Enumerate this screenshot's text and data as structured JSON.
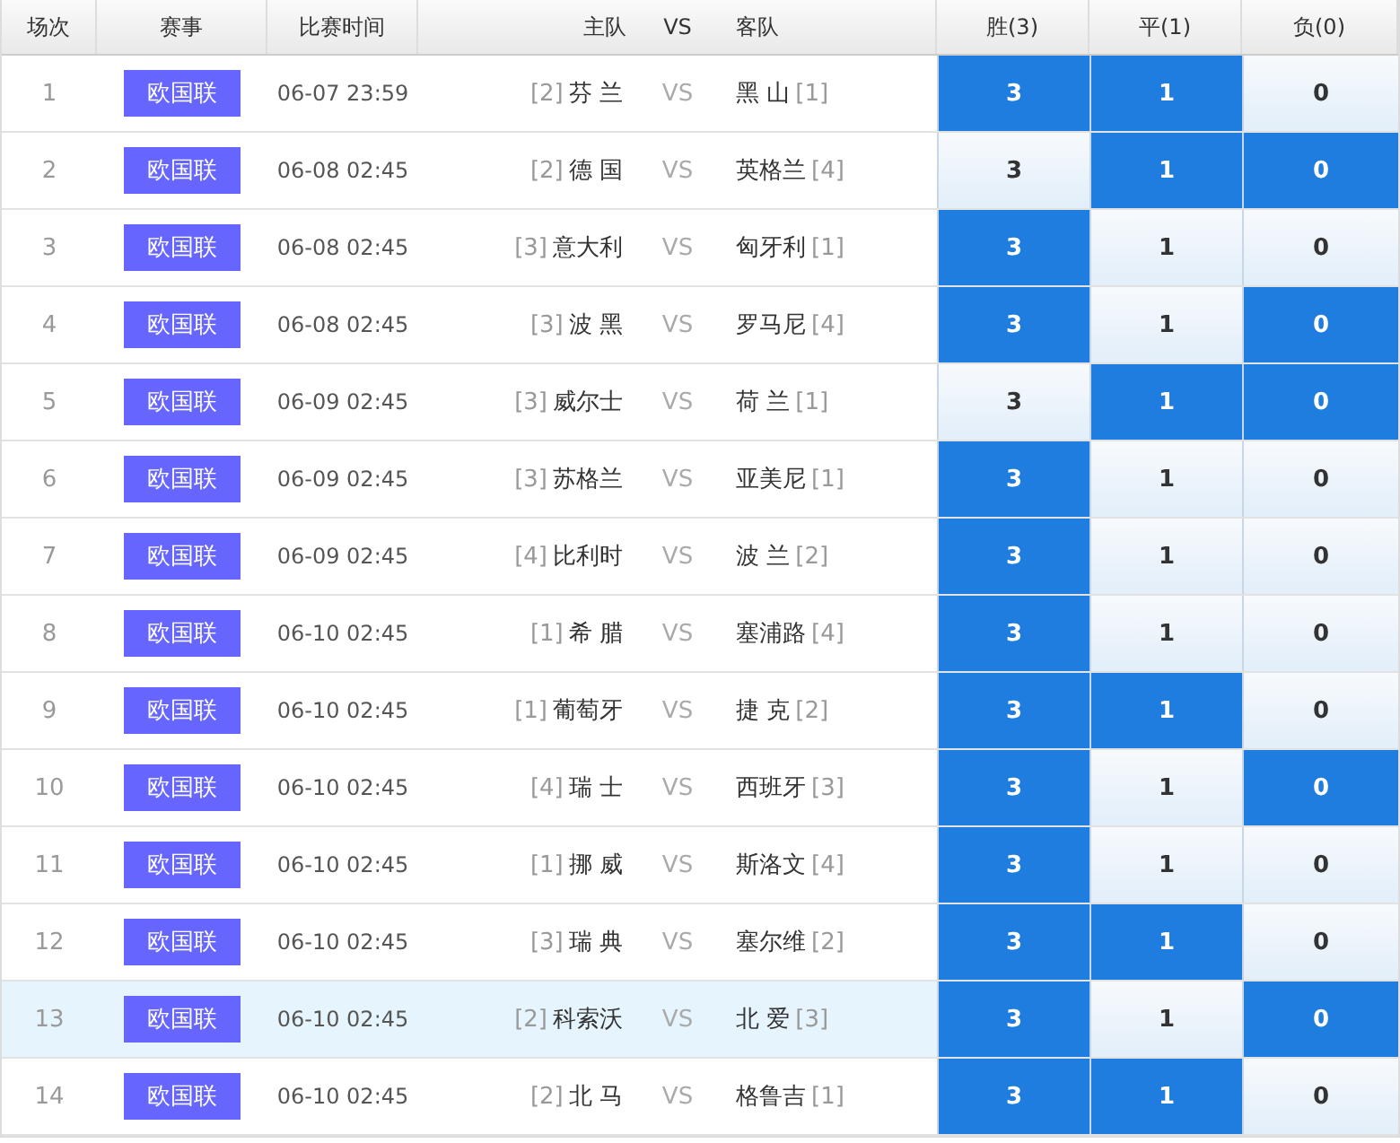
{
  "columns": [
    "场次",
    "赛事",
    "比赛时间",
    "主队",
    "VS",
    "客队",
    "胜(3)",
    "平(1)",
    "负(0)"
  ],
  "rows": [
    {
      "no": "1",
      "league": "欧国联",
      "time": "06-07 23:59",
      "home_rank": "[2]",
      "home": "芬 兰",
      "vs": "VS",
      "away": "黑 山",
      "away_rank": "[1]",
      "highlighted": false,
      "odds": [
        {
          "label": "3",
          "selected": true
        },
        {
          "label": "1",
          "selected": true
        },
        {
          "label": "0",
          "selected": false
        }
      ]
    },
    {
      "no": "2",
      "league": "欧国联",
      "time": "06-08 02:45",
      "home_rank": "[2]",
      "home": "德 国",
      "vs": "VS",
      "away": "英格兰",
      "away_rank": "[4]",
      "highlighted": false,
      "odds": [
        {
          "label": "3",
          "selected": false
        },
        {
          "label": "1",
          "selected": true
        },
        {
          "label": "0",
          "selected": true
        }
      ]
    },
    {
      "no": "3",
      "league": "欧国联",
      "time": "06-08 02:45",
      "home_rank": "[3]",
      "home": "意大利",
      "vs": "VS",
      "away": "匈牙利",
      "away_rank": "[1]",
      "highlighted": false,
      "odds": [
        {
          "label": "3",
          "selected": true
        },
        {
          "label": "1",
          "selected": false
        },
        {
          "label": "0",
          "selected": false
        }
      ]
    },
    {
      "no": "4",
      "league": "欧国联",
      "time": "06-08 02:45",
      "home_rank": "[3]",
      "home": "波 黑",
      "vs": "VS",
      "away": "罗马尼",
      "away_rank": "[4]",
      "highlighted": false,
      "odds": [
        {
          "label": "3",
          "selected": true
        },
        {
          "label": "1",
          "selected": false
        },
        {
          "label": "0",
          "selected": true
        }
      ]
    },
    {
      "no": "5",
      "league": "欧国联",
      "time": "06-09 02:45",
      "home_rank": "[3]",
      "home": "威尔士",
      "vs": "VS",
      "away": "荷 兰",
      "away_rank": "[1]",
      "highlighted": false,
      "odds": [
        {
          "label": "3",
          "selected": false
        },
        {
          "label": "1",
          "selected": true
        },
        {
          "label": "0",
          "selected": true
        }
      ]
    },
    {
      "no": "6",
      "league": "欧国联",
      "time": "06-09 02:45",
      "home_rank": "[3]",
      "home": "苏格兰",
      "vs": "VS",
      "away": "亚美尼",
      "away_rank": "[1]",
      "highlighted": false,
      "odds": [
        {
          "label": "3",
          "selected": true
        },
        {
          "label": "1",
          "selected": false
        },
        {
          "label": "0",
          "selected": false
        }
      ]
    },
    {
      "no": "7",
      "league": "欧国联",
      "time": "06-09 02:45",
      "home_rank": "[4]",
      "home": "比利时",
      "vs": "VS",
      "away": "波 兰",
      "away_rank": "[2]",
      "highlighted": false,
      "odds": [
        {
          "label": "3",
          "selected": true
        },
        {
          "label": "1",
          "selected": false
        },
        {
          "label": "0",
          "selected": false
        }
      ]
    },
    {
      "no": "8",
      "league": "欧国联",
      "time": "06-10 02:45",
      "home_rank": "[1]",
      "home": "希 腊",
      "vs": "VS",
      "away": "塞浦路",
      "away_rank": "[4]",
      "highlighted": false,
      "odds": [
        {
          "label": "3",
          "selected": true
        },
        {
          "label": "1",
          "selected": false
        },
        {
          "label": "0",
          "selected": false
        }
      ]
    },
    {
      "no": "9",
      "league": "欧国联",
      "time": "06-10 02:45",
      "home_rank": "[1]",
      "home": "葡萄牙",
      "vs": "VS",
      "away": "捷 克",
      "away_rank": "[2]",
      "highlighted": false,
      "odds": [
        {
          "label": "3",
          "selected": true
        },
        {
          "label": "1",
          "selected": true
        },
        {
          "label": "0",
          "selected": false
        }
      ]
    },
    {
      "no": "10",
      "league": "欧国联",
      "time": "06-10 02:45",
      "home_rank": "[4]",
      "home": "瑞 士",
      "vs": "VS",
      "away": "西班牙",
      "away_rank": "[3]",
      "highlighted": false,
      "odds": [
        {
          "label": "3",
          "selected": true
        },
        {
          "label": "1",
          "selected": false
        },
        {
          "label": "0",
          "selected": true
        }
      ]
    },
    {
      "no": "11",
      "league": "欧国联",
      "time": "06-10 02:45",
      "home_rank": "[1]",
      "home": "挪 威",
      "vs": "VS",
      "away": "斯洛文",
      "away_rank": "[4]",
      "highlighted": false,
      "odds": [
        {
          "label": "3",
          "selected": true
        },
        {
          "label": "1",
          "selected": false
        },
        {
          "label": "0",
          "selected": false
        }
      ]
    },
    {
      "no": "12",
      "league": "欧国联",
      "time": "06-10 02:45",
      "home_rank": "[3]",
      "home": "瑞 典",
      "vs": "VS",
      "away": "塞尔维",
      "away_rank": "[2]",
      "highlighted": false,
      "odds": [
        {
          "label": "3",
          "selected": true
        },
        {
          "label": "1",
          "selected": true
        },
        {
          "label": "0",
          "selected": false
        }
      ]
    },
    {
      "no": "13",
      "league": "欧国联",
      "time": "06-10 02:45",
      "home_rank": "[2]",
      "home": "科索沃",
      "vs": "VS",
      "away": "北 爱",
      "away_rank": "[3]",
      "highlighted": true,
      "odds": [
        {
          "label": "3",
          "selected": true
        },
        {
          "label": "1",
          "selected": false
        },
        {
          "label": "0",
          "selected": true
        }
      ]
    },
    {
      "no": "14",
      "league": "欧国联",
      "time": "06-10 02:45",
      "home_rank": "[2]",
      "home": "北 马",
      "vs": "VS",
      "away": "格鲁吉",
      "away_rank": "[1]",
      "highlighted": false,
      "odds": [
        {
          "label": "3",
          "selected": true
        },
        {
          "label": "1",
          "selected": true
        },
        {
          "label": "0",
          "selected": false
        }
      ]
    }
  ]
}
